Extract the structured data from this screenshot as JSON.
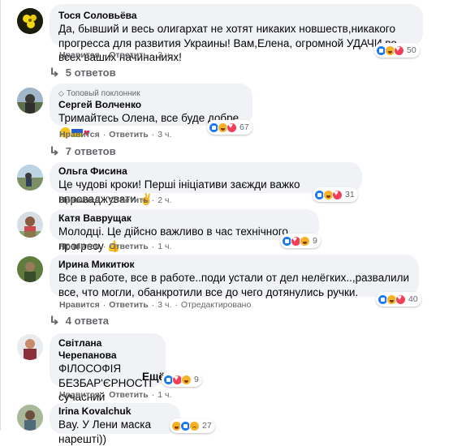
{
  "comments": [
    {
      "author": "Тося Соловьёва",
      "text": "Да, бывший и весь олигархат не хотят никаких новшеств,никакого прогресса для развития Украины! Вам,Елена, огромной УДАЧИ во всех ваших начинаниях!",
      "like_label": "Нравится",
      "reply_label": "Ответить",
      "time": "3 ч.",
      "reaction_count": "50",
      "replies_label": "5 ответов"
    },
    {
      "badge": "Топовый поклонник",
      "author": "Сергей Волченко",
      "text": "Тримайтесь Олена, все буде добре",
      "like_label": "Нравится",
      "reply_label": "Ответить",
      "time": "3 ч.",
      "reaction_count": "67",
      "replies_label": "7 ответов"
    },
    {
      "author": "Ольга Фисина",
      "text": "Це чудові кроки! Перші ініціативи заєжди важко впроваджувати.",
      "like_label": "Нравится",
      "reply_label": "Ответить",
      "time": "2 ч.",
      "reaction_count": "31"
    },
    {
      "author": "Катя Ваврущак",
      "text": "Молодці. Це дійсно важливо в час технічного прогресу",
      "like_label": "Нравится",
      "reply_label": "Ответить",
      "time": "1 ч.",
      "reaction_count": "9"
    },
    {
      "author": "Ирина Микитюк",
      "text": "Все в работе, все в работе..поди устали от дел нелёгких..,развалили все, что могли, обанкротили все до чего дотянулись ручки.",
      "like_label": "Нравится",
      "reply_label": "Ответить",
      "time": "3 ч.",
      "edited_label": "Отредактировано",
      "reaction_count": "40",
      "replies_label": "4 ответа"
    },
    {
      "author": "Світлана Черепанова",
      "text": "ФІЛОСОФІЯ\nБЕЗБАР'ЄРНОСТІ\nсучасний ВИКЛИК...",
      "more_label": "Ещё",
      "like_label": "Нравится",
      "reply_label": "Ответить",
      "time": "1 ч.",
      "reaction_count": "9"
    },
    {
      "author": "Irina Kovalchuk",
      "text": "Вау. У Лени маска нарешті))",
      "reaction_count": "27"
    }
  ],
  "colors": {
    "bubble": "#f0f2f5",
    "meta": "#65676b",
    "like": "#1877f2",
    "love": "#f33e58",
    "haha": "#f7b125"
  }
}
